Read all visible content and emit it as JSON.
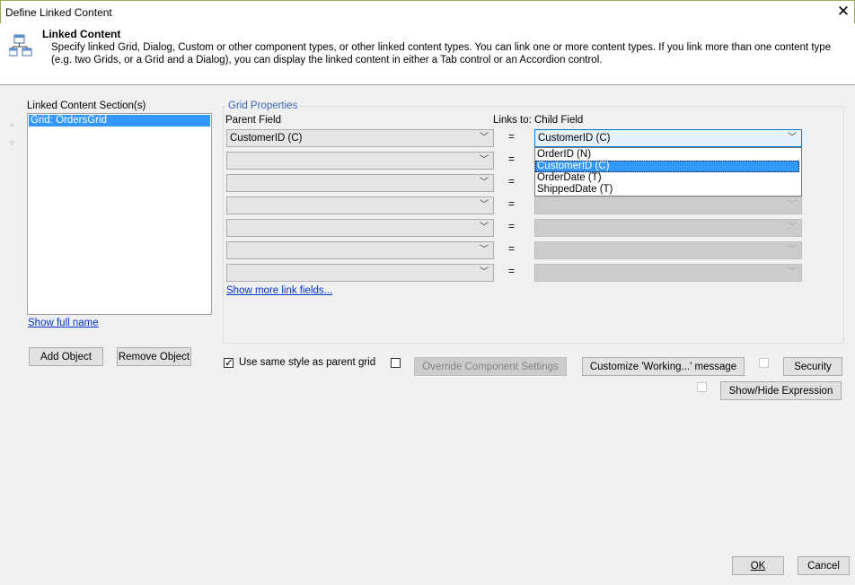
{
  "window": {
    "title": "Define Linked Content",
    "close_glyph": "✕"
  },
  "header": {
    "title": "Linked Content",
    "description": "Specify linked Grid, Dialog, Custom or other component types, or other linked content types. You can link one or more content types. If you link more than one content type (e.g. two Grids, or a Grid and a Dialog), you can display the linked content in either a Tab control or an Accordion control."
  },
  "sections": {
    "label": "Linked Content Section(s)",
    "items": [
      "Grid: OrdersGrid"
    ],
    "show_full_name": "Show full name",
    "add_object": "Add Object",
    "remove_object": "Remove Object"
  },
  "grid_properties": {
    "title": "Grid Properties",
    "parent_field_label": "Parent Field",
    "links_to_label": "Links to:",
    "child_field_label": "Child Field",
    "equals": "=",
    "rows": [
      {
        "parent": "CustomerID (C)",
        "child": "CustomerID (C)"
      },
      {
        "parent": "",
        "child": ""
      },
      {
        "parent": "",
        "child": ""
      },
      {
        "parent": "",
        "child": ""
      },
      {
        "parent": "",
        "child": ""
      },
      {
        "parent": "",
        "child": ""
      },
      {
        "parent": "",
        "child": ""
      }
    ],
    "show_more": "Show more link fields...",
    "dropdown_options": [
      "OrderID (N)",
      "CustomerID (C)",
      "OrderDate (T)",
      "ShippedDate (T)"
    ],
    "dropdown_selected_index": 1
  },
  "options": {
    "use_same_style": "Use same style as parent grid",
    "use_same_style_checked": true,
    "override_component": "Override Component Settings",
    "customize_working": "Customize 'Working...' message",
    "security": "Security",
    "show_hide_expression": "Show/Hide Expression"
  },
  "footer": {
    "ok": "OK",
    "cancel": "Cancel"
  },
  "colors": {
    "selection": "#3399ff",
    "accent_link": "#0033cc",
    "group_title": "#3a66b5"
  }
}
